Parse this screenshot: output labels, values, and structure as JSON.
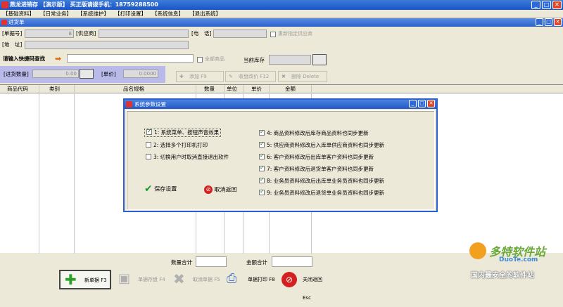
{
  "window": {
    "title": "燕龙进销存 【演示版】 买正版请拨手机：18759288500"
  },
  "menu": [
    "【基础资料】",
    "【日常业务】",
    "【系统维护】",
    "【打印设置】",
    "【系统信息】",
    "【退出系统】"
  ],
  "subwindow": {
    "title": "进货单"
  },
  "form": {
    "doc_no_label": "[单据号]",
    "doc_no_value": "8",
    "supplier_label": "[供应商]",
    "phone_label": "[电　话]",
    "remember_label": "重新指定供应商",
    "address_label": "[地　址]",
    "scan_label": "请输入快捷码查找",
    "all_goods_label": "全部商品",
    "stock_label": "当前库存",
    "qty_label": "[进货数量]",
    "qty_value": "0.00",
    "price_label": "[单价]",
    "price_value": "0.0000",
    "add_btn": "添加 F9",
    "edit_btn": "收盘改价 F12",
    "delete_btn": "删除 Delete"
  },
  "grid": {
    "columns": [
      "商品代码",
      "类别",
      "品名规格",
      "数量",
      "单位",
      "单价",
      "金额"
    ]
  },
  "footer": {
    "qty_total_label": "数量合计",
    "amount_total_label": "金额合计",
    "new_btn": "新单据 F3",
    "save_btn": "单据存盘 F4",
    "cancel_btn": "取消单据 F5",
    "print_btn": "单据打印 F8",
    "close_btn": "关闭返回 Esc"
  },
  "dialog": {
    "title": "系统参数设置",
    "options_left": [
      {
        "label": "1: 系统菜单、按钮声音效果",
        "checked": true
      },
      {
        "label": "2: 选择多个打印机打印",
        "checked": false
      },
      {
        "label": "3: 切换用户时取消直接退出软件",
        "checked": false
      }
    ],
    "options_right": [
      {
        "label": "4: 商品资料修改后库存商品资料也同步更新",
        "checked": true
      },
      {
        "label": "5: 供应商资料修改后入库单供应商资料也同步更新",
        "checked": true
      },
      {
        "label": "6: 客户资料修改后出库单客户资料也同步更新",
        "checked": true
      },
      {
        "label": "7: 客户资料修改后退货单客户资料也同步更新",
        "checked": true
      },
      {
        "label": "8: 业务员资料修改后出库单业务员资料也同步更新",
        "checked": true
      },
      {
        "label": "9: 业务员资料修改后退货单业务员资料也同步更新",
        "checked": true
      }
    ],
    "save_btn": "保存设置",
    "cancel_btn": "取消返回"
  },
  "watermark": {
    "brand": "多特软件站",
    "site": "DuoTe.com",
    "slogan": "国内最安全的软件站"
  },
  "colors": {
    "titlebar": "#1a55c7",
    "accent": "#3c8ad8",
    "ok": "#1a9a2a",
    "cancel": "#d42020"
  }
}
